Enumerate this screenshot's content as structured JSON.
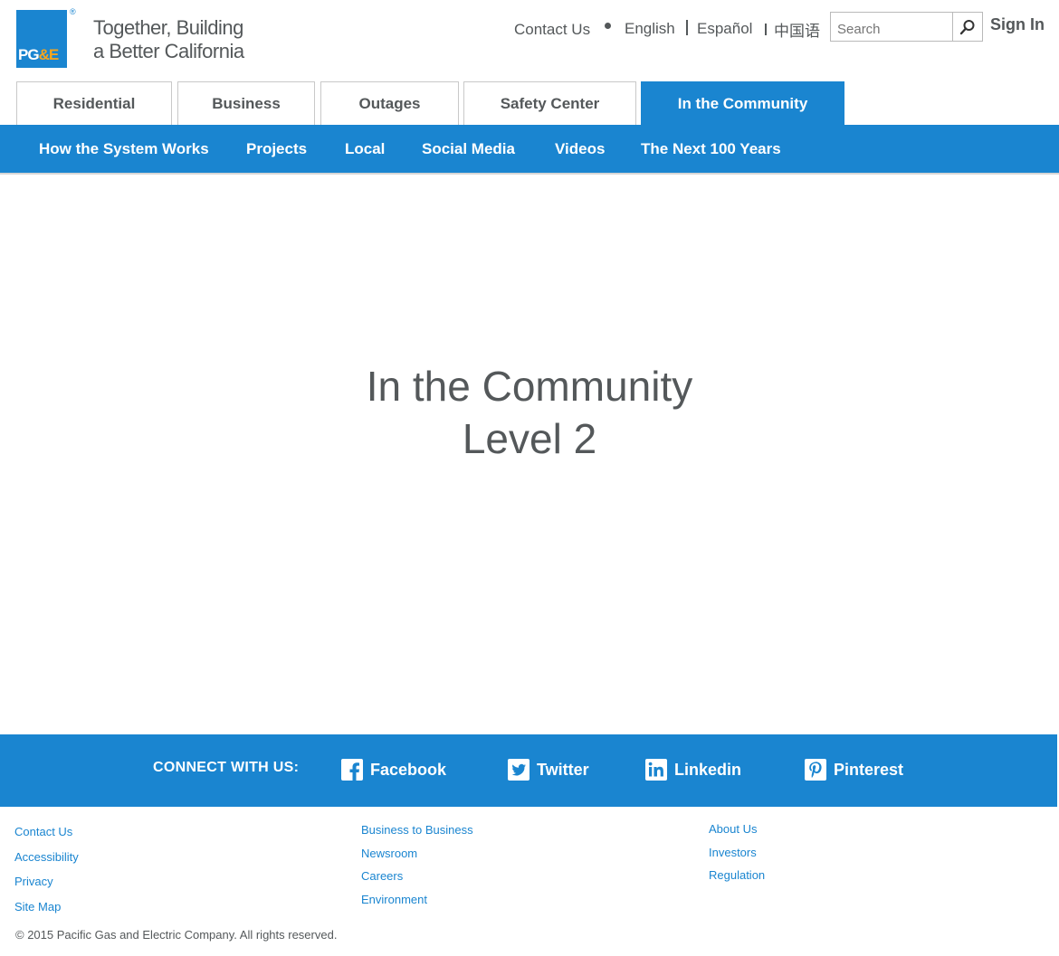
{
  "header": {
    "logo_reg": "®",
    "logo_text_pg": "PG",
    "logo_text_amp": "&",
    "logo_text_e": "E",
    "tagline_line1": "Together, Building",
    "tagline_line2": "a Better California",
    "contact_us": "Contact Us",
    "lang_english": "English",
    "lang_espanol": "Español",
    "lang_chinese": "中国语",
    "search_placeholder": "Search",
    "sign_in": "Sign In"
  },
  "primary_tabs": [
    {
      "label": "Residential"
    },
    {
      "label": "Business"
    },
    {
      "label": "Outages"
    },
    {
      "label": "Safety Center"
    },
    {
      "label": "In the Community",
      "active": true
    }
  ],
  "sub_nav": [
    {
      "label": "How the System Works"
    },
    {
      "label": "Projects"
    },
    {
      "label": "Local"
    },
    {
      "label": "Social Media"
    },
    {
      "label": "Videos"
    },
    {
      "label": "The Next 100 Years"
    }
  ],
  "hero": {
    "line1": "In the Community",
    "line2": "Level 2"
  },
  "connect": {
    "label": "CONNECT WITH US:",
    "facebook": "Facebook",
    "twitter": "Twitter",
    "linkedin": "Linkedin",
    "pinterest": "Pinterest"
  },
  "footer": {
    "col1": [
      "Contact Us",
      "Accessibility",
      "Privacy",
      "Site Map"
    ],
    "col2": [
      "Business to Business",
      "Newsroom",
      "Careers",
      "Environment"
    ],
    "col3": [
      "About Us",
      "Investors",
      "Regulation"
    ],
    "copyright": "© 2015  Pacific Gas and Electric Company. All rights reserved."
  },
  "colors": {
    "brand_blue": "#1a85d0",
    "brand_orange": "#f7a51c",
    "text_gray": "#54585a"
  }
}
